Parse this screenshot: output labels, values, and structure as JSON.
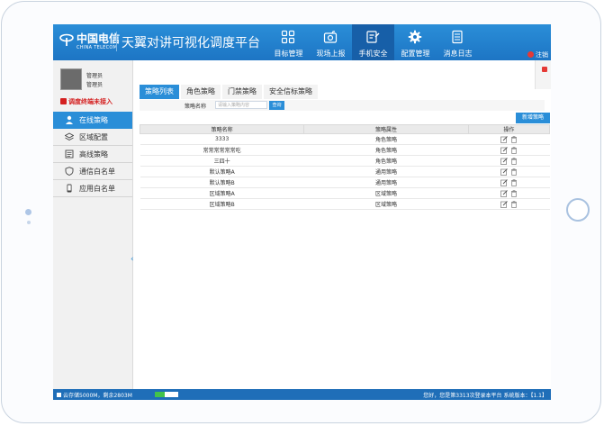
{
  "header": {
    "logo_cn": "中国电信",
    "logo_en": "CHINA TELECOM",
    "title": "天翼对讲可视化调度平台",
    "nav": [
      {
        "label": "目标管理",
        "icon": "grid-icon",
        "active": false
      },
      {
        "label": "现场上报",
        "icon": "camera-icon",
        "active": false
      },
      {
        "label": "手机安全",
        "icon": "clipboard-edit-icon",
        "active": true
      },
      {
        "label": "配置管理",
        "icon": "gear-icon",
        "active": false
      },
      {
        "label": "消息日志",
        "icon": "document-icon",
        "active": false
      }
    ],
    "logout": "注销"
  },
  "sidebar": {
    "user_name": "管理员",
    "user_role": "管理员",
    "warning": "调度终端未接入",
    "items": [
      {
        "label": "在线策略",
        "icon": "user-icon",
        "active": true
      },
      {
        "label": "区域配置",
        "icon": "layers-icon",
        "active": false
      },
      {
        "label": "高线策略",
        "icon": "list-icon",
        "active": false
      },
      {
        "label": "通信白名单",
        "icon": "shield-icon",
        "active": false
      },
      {
        "label": "应用白名单",
        "icon": "phone-icon",
        "active": false
      }
    ]
  },
  "tabs": [
    {
      "label": "策略列表",
      "active": true
    },
    {
      "label": "角色策略",
      "active": false
    },
    {
      "label": "门禁策略",
      "active": false
    },
    {
      "label": "安全信标策略",
      "active": false
    }
  ],
  "search": {
    "label": "策略名称",
    "placeholder": "请输入策略内容",
    "button": "查询"
  },
  "add_button": "新增策略",
  "table": {
    "headers": [
      "策略名称",
      "策略属性",
      "操作"
    ],
    "rows": [
      {
        "name": "3333",
        "attr": "角色策略"
      },
      {
        "name": "常常常常常常吃",
        "attr": "角色策略"
      },
      {
        "name": "三四十",
        "attr": "角色策略"
      },
      {
        "name": "默认策略A",
        "attr": "通用策略"
      },
      {
        "name": "默认策略B",
        "attr": "通用策略"
      },
      {
        "name": "区域策略A",
        "attr": "区域策略"
      },
      {
        "name": "区域策略B",
        "attr": "区域策略"
      }
    ]
  },
  "status": {
    "storage": "云存储5000M，剩余2803M",
    "storage_used_fraction": 0.44,
    "right_text": "您好，您是第3313次登录本平台  系统版本：【1.1】"
  },
  "colors": {
    "primary": "#2a8ed8",
    "header_active": "#175fa8",
    "warning": "#d42020",
    "status_bar": "#1f6eb8"
  }
}
